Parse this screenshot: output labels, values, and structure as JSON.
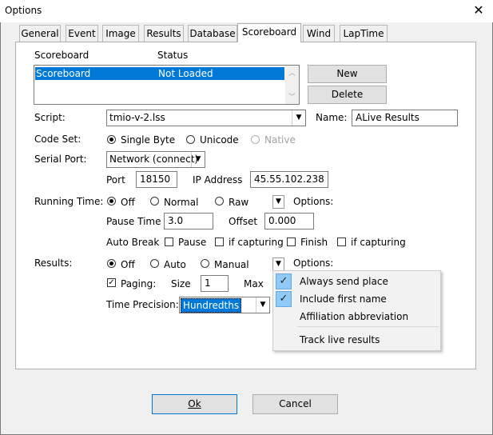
{
  "window": {
    "title": "Options"
  },
  "tabs": [
    "General",
    "Event",
    "Image",
    "Results",
    "Database",
    "Scoreboard",
    "Wind",
    "LapTime"
  ],
  "list": {
    "col_scoreboard": "Scoreboard",
    "col_status": "Status",
    "rows": [
      {
        "name": "Scoreboard",
        "status": "Not Loaded"
      }
    ]
  },
  "buttons": {
    "new": "New",
    "delete": "Delete",
    "ok": "Ok",
    "cancel": "Cancel"
  },
  "script": {
    "label": "Script:",
    "value": "tmio-v-2.lss"
  },
  "name": {
    "label": "Name:",
    "value": "ALive Results"
  },
  "code_set": {
    "label": "Code Set:",
    "options": [
      "Single Byte",
      "Unicode",
      "Native"
    ],
    "selected": "Single Byte"
  },
  "serial_port": {
    "label": "Serial Port:",
    "value": "Network (connect)"
  },
  "port": {
    "label": "Port",
    "value": "18150"
  },
  "ip": {
    "label": "IP Address",
    "value": "45.55.102.238"
  },
  "running_time": {
    "label": "Running Time:",
    "options": [
      "Off",
      "Normal",
      "Raw"
    ],
    "selected": "Off",
    "options_label": "Options:"
  },
  "pause_time": {
    "label": "Pause Time",
    "value": "3.0"
  },
  "offset": {
    "label": "Offset",
    "value": "0.000"
  },
  "auto_break": {
    "label": "Auto Break",
    "pause": "Pause",
    "if_capturing_1": "if capturing",
    "finish": "Finish",
    "if_capturing_2": "if capturing"
  },
  "results": {
    "label": "Results:",
    "options": [
      "Off",
      "Auto",
      "Manual"
    ],
    "selected": "Off",
    "options_label": "Options:"
  },
  "paging": {
    "label": "Paging:",
    "checked": true,
    "size_label": "Size",
    "size_value": "1",
    "max_label": "Max"
  },
  "time_precision": {
    "label": "Time Precision:",
    "value": "Hundredths"
  },
  "menu": {
    "items": [
      {
        "label": "Always send place",
        "checked": true
      },
      {
        "label": "Include first name",
        "checked": true
      },
      {
        "label": "Affiliation abbreviation",
        "checked": false
      },
      {
        "label": "Track live results",
        "checked": false
      }
    ]
  },
  "colors": {
    "selection": "#0078d7",
    "menu_check_bg": "#91c9f7"
  }
}
